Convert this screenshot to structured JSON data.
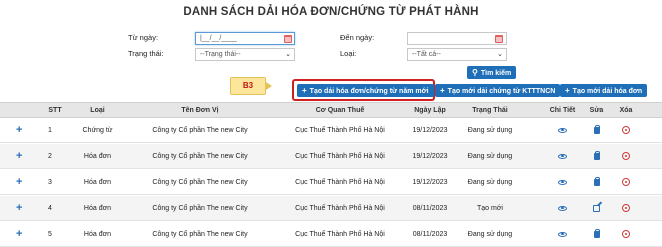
{
  "title": "DANH SÁCH DẢI HÓA ĐƠN/CHỨNG TỪ PHÁT HÀNH",
  "filters": {
    "tu_ngay_label": "Từ ngày:",
    "tu_ngay_value": "|__/__/____",
    "den_ngay_label": "Đến ngày:",
    "den_ngay_value": "",
    "trang_thai_label": "Trạng thái:",
    "trang_thai_value": "--Trạng thái--",
    "loai_label": "Loại:",
    "loai_value": "--Tất cả--"
  },
  "buttons": {
    "search": "Tìm kiếm",
    "create_range_year": "Tạo dải hóa đơn/chứng từ năm mới",
    "create_range_tncn": "Tạo mới dải chứng từ KTTTNCN",
    "create_range_invoice": "Tạo mới dải hóa đơn"
  },
  "callout": "B3",
  "columns": [
    "STT",
    "Loại",
    "Tên Đơn Vị",
    "Cơ Quan Thuế",
    "Ngày Lập",
    "Trạng Thái",
    "Chi Tiết",
    "Sửa",
    "Xóa"
  ],
  "rows": [
    {
      "stt": "1",
      "loai": "Chứng từ",
      "ten_don_vi": "Công ty Cổ phần The new City",
      "co_quan_thue": "Cục Thuế Thành Phố Hà Nội",
      "ngay_lap": "19/12/2023",
      "trang_thai": "Đang sử dụng",
      "edit_icon": "bag-icon"
    },
    {
      "stt": "2",
      "loai": "Hóa đơn",
      "ten_don_vi": "Công ty Cổ phần The new City",
      "co_quan_thue": "Cục Thuế Thành Phố Hà Nội",
      "ngay_lap": "19/12/2023",
      "trang_thai": "Đang sử dụng",
      "edit_icon": "bag-icon"
    },
    {
      "stt": "3",
      "loai": "Hóa đơn",
      "ten_don_vi": "Công ty Cổ phần The new City",
      "co_quan_thue": "Cục Thuế Thành Phố Hà Nội",
      "ngay_lap": "19/12/2023",
      "trang_thai": "Đang sử dụng",
      "edit_icon": "bag-icon"
    },
    {
      "stt": "4",
      "loai": "Hóa đơn",
      "ten_don_vi": "Công ty Cổ phần The new City",
      "co_quan_thue": "Cục Thuế Thành Phố Hà Nội",
      "ngay_lap": "08/11/2023",
      "trang_thai": "Tạo mới",
      "edit_icon": "edit-icon"
    },
    {
      "stt": "5",
      "loai": "Hóa đơn",
      "ten_don_vi": "Công ty Cổ phần The new City",
      "co_quan_thue": "Cục Thuế Thành Phố Hà Nội",
      "ngay_lap": "08/11/2023",
      "trang_thai": "Đang sử dụng",
      "edit_icon": "bag-icon"
    }
  ],
  "colors": {
    "primary": "#1f6eb8",
    "delete": "#d03a3a",
    "callout_bg": "#fbe69c",
    "highlight": "#cc2222"
  }
}
